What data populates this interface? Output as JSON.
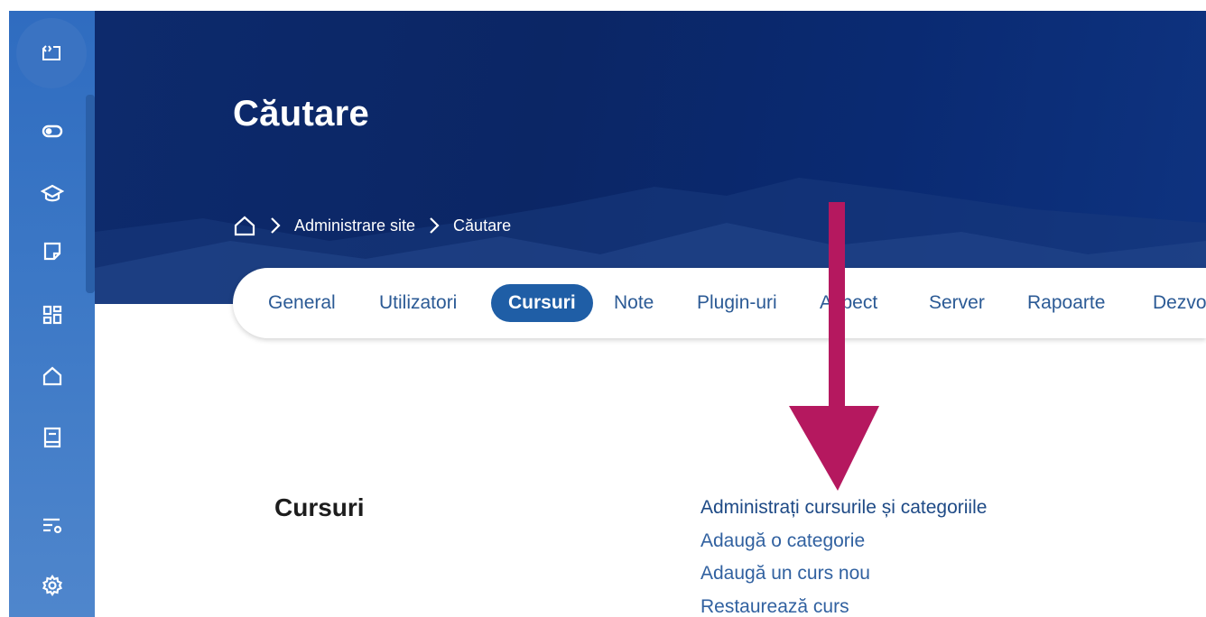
{
  "rail": {
    "top_icon": "sidebar-toggle-icon",
    "items": [
      {
        "icon": "toggle-icon"
      },
      {
        "icon": "graduation-cap-icon"
      },
      {
        "icon": "note-icon"
      },
      {
        "icon": "dashboard-grid-icon"
      },
      {
        "icon": "home-icon"
      },
      {
        "icon": "book-icon"
      },
      {
        "icon": "list-settings-icon"
      },
      {
        "icon": "gear-icon"
      }
    ]
  },
  "header": {
    "title": "Căutare",
    "breadcrumb": {
      "home_icon": "home-icon",
      "items": [
        "Administrare site",
        "Căutare"
      ]
    }
  },
  "tabs": [
    {
      "label": "General"
    },
    {
      "label": "Utilizatori"
    },
    {
      "label": "Cursuri",
      "active": true
    },
    {
      "label": "Note"
    },
    {
      "label": "Plugin-uri"
    },
    {
      "label": "Aspect"
    },
    {
      "label": "Server"
    },
    {
      "label": "Rapoarte"
    },
    {
      "label": "Dezvoltare"
    }
  ],
  "section": {
    "title": "Cursuri",
    "links": [
      "Administrați cursurile și categoriile",
      "Adaugă o categorie",
      "Adaugă un curs nou",
      "Restaurează curs"
    ]
  },
  "annotation": {
    "arrow_color": "#b5185f"
  },
  "colors": {
    "rail": "#3c78c6",
    "hero": "#0b2665",
    "active_tab": "#1f5ea6",
    "link": "#3161a0"
  }
}
